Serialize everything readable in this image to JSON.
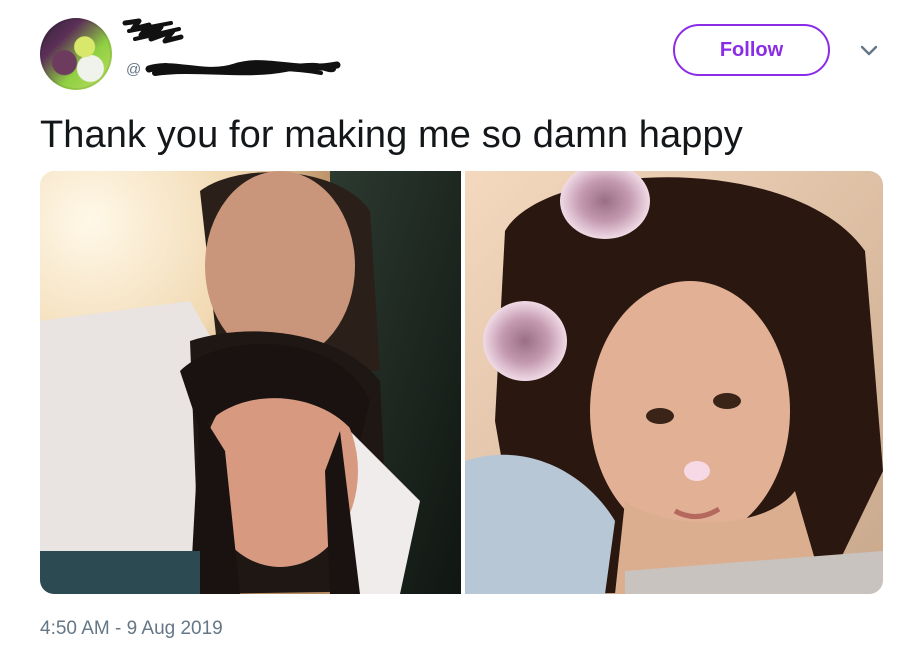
{
  "tweet": {
    "handle_prefix": "@",
    "follow_label": "Follow",
    "text": "Thank you for making me so damn happy",
    "timestamp": "4:50 AM - 9 Aug 2019"
  },
  "colors": {
    "follow_accent": "#8b2ce6",
    "secondary_text": "#657786",
    "primary_text": "#14171a"
  },
  "icons": {
    "menu": "chevron-down-icon"
  }
}
